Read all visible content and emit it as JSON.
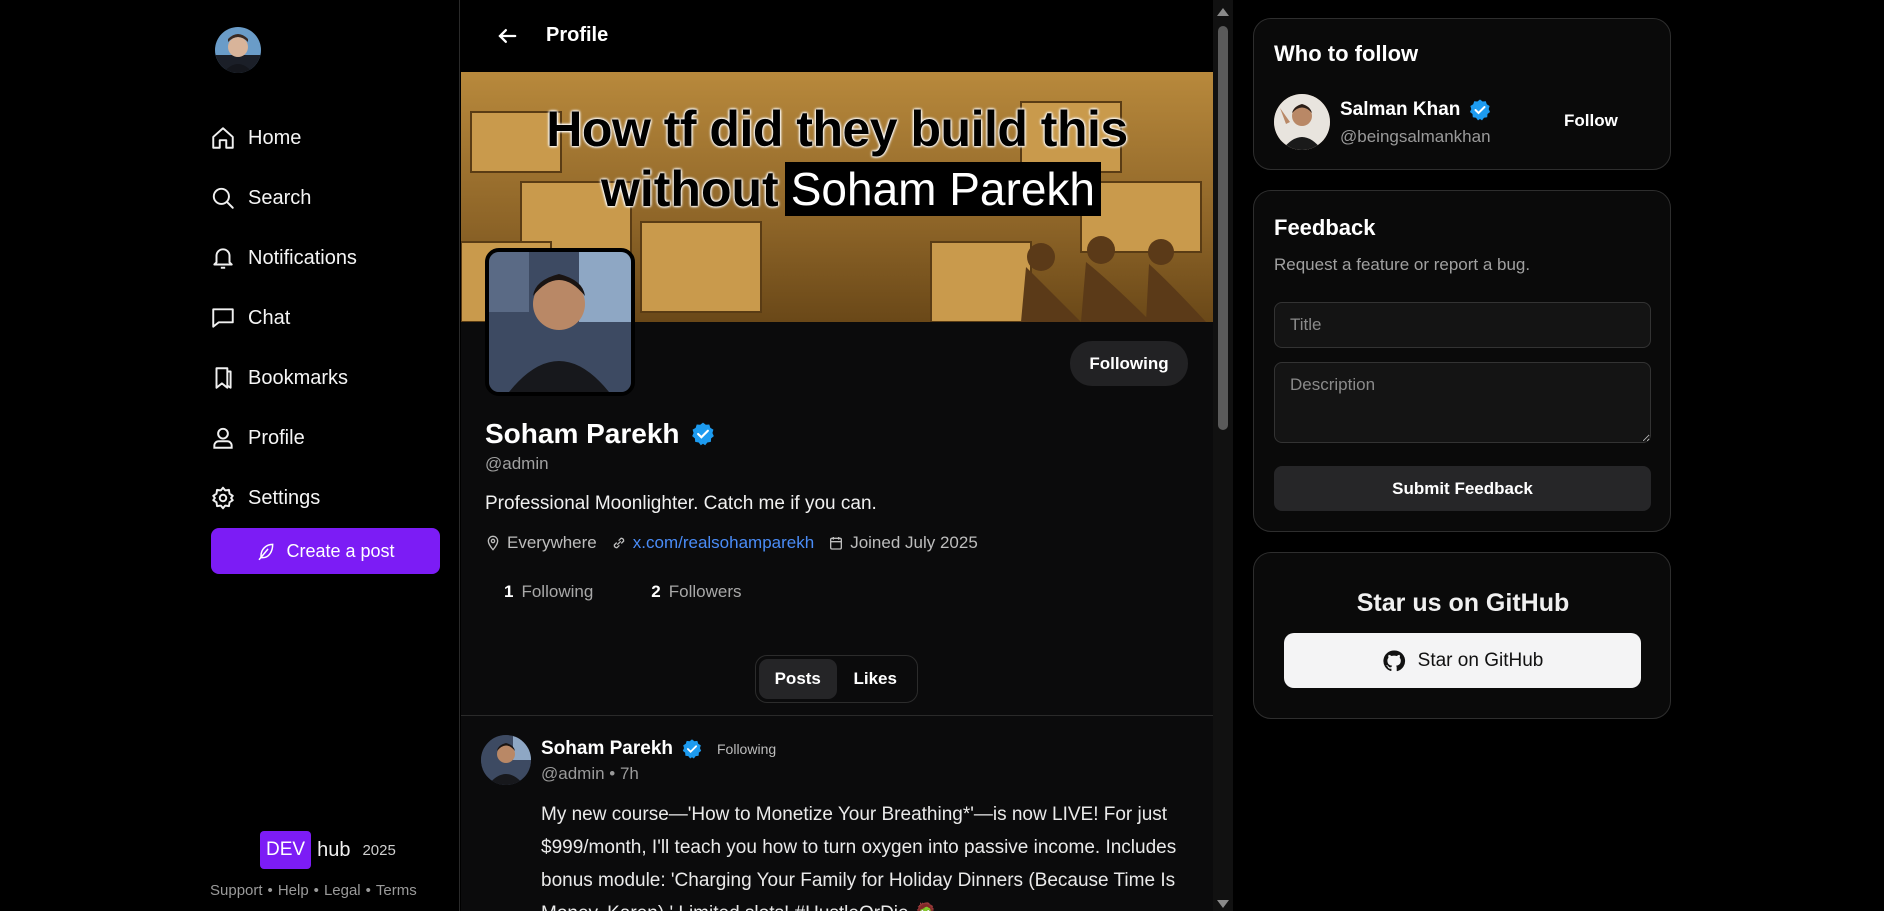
{
  "sidebar": {
    "nav": [
      {
        "label": "Home",
        "icon": "home-icon"
      },
      {
        "label": "Search",
        "icon": "search-icon"
      },
      {
        "label": "Notifications",
        "icon": "bell-icon"
      },
      {
        "label": "Chat",
        "icon": "chat-icon"
      },
      {
        "label": "Bookmarks",
        "icon": "bookmark-icon"
      },
      {
        "label": "Profile",
        "icon": "user-icon"
      },
      {
        "label": "Settings",
        "icon": "gear-icon"
      }
    ],
    "create_post_label": "Create a post",
    "brand": {
      "dev": "DEV",
      "hub": "hub",
      "year": "2025"
    },
    "footer_links": [
      "Support",
      "Help",
      "Legal",
      "Terms"
    ],
    "footer_sep": "•"
  },
  "header": {
    "title": "Profile"
  },
  "banner": {
    "line1": "How tf did they build this",
    "line2_prefix": "without",
    "line2_highlight": "Soham Parekh"
  },
  "profile": {
    "name": "Soham Parekh",
    "handle": "@admin",
    "bio": "Professional Moonlighter. Catch me if you can.",
    "location": "Everywhere",
    "website": "x.com/realsohamparekh",
    "joined": "Joined July 2025",
    "following_count": "1",
    "following_label": "Following",
    "followers_count": "2",
    "followers_label": "Followers",
    "follow_button": "Following"
  },
  "tabs": [
    {
      "label": "Posts",
      "active": true
    },
    {
      "label": "Likes",
      "active": false
    }
  ],
  "post": {
    "author": "Soham Parekh",
    "status": "Following",
    "handle_time": "@admin • 7h",
    "body": "My new course—'How to Monetize Your Breathing*'—is now LIVE! For just $999/month, I'll teach you how to turn oxygen into passive income. Includes bonus module: 'Charging Your Family for Holiday Dinners (Because Time Is Money, Karen).' Limited slots! #HustleOrDie 🧟"
  },
  "who_to_follow": {
    "title": "Who to follow",
    "user": {
      "name": "Salman Khan",
      "handle": "@beingsalmankhan",
      "button": "Follow"
    }
  },
  "feedback": {
    "title": "Feedback",
    "subtitle": "Request a feature or report a bug.",
    "title_placeholder": "Title",
    "desc_placeholder": "Description",
    "submit": "Submit Feedback"
  },
  "github": {
    "title": "Star us on GitHub",
    "button": "Star on GitHub"
  },
  "colors": {
    "accent": "#7c1cf5",
    "link": "#4a8cf7",
    "verified": "#1d9bf0"
  }
}
